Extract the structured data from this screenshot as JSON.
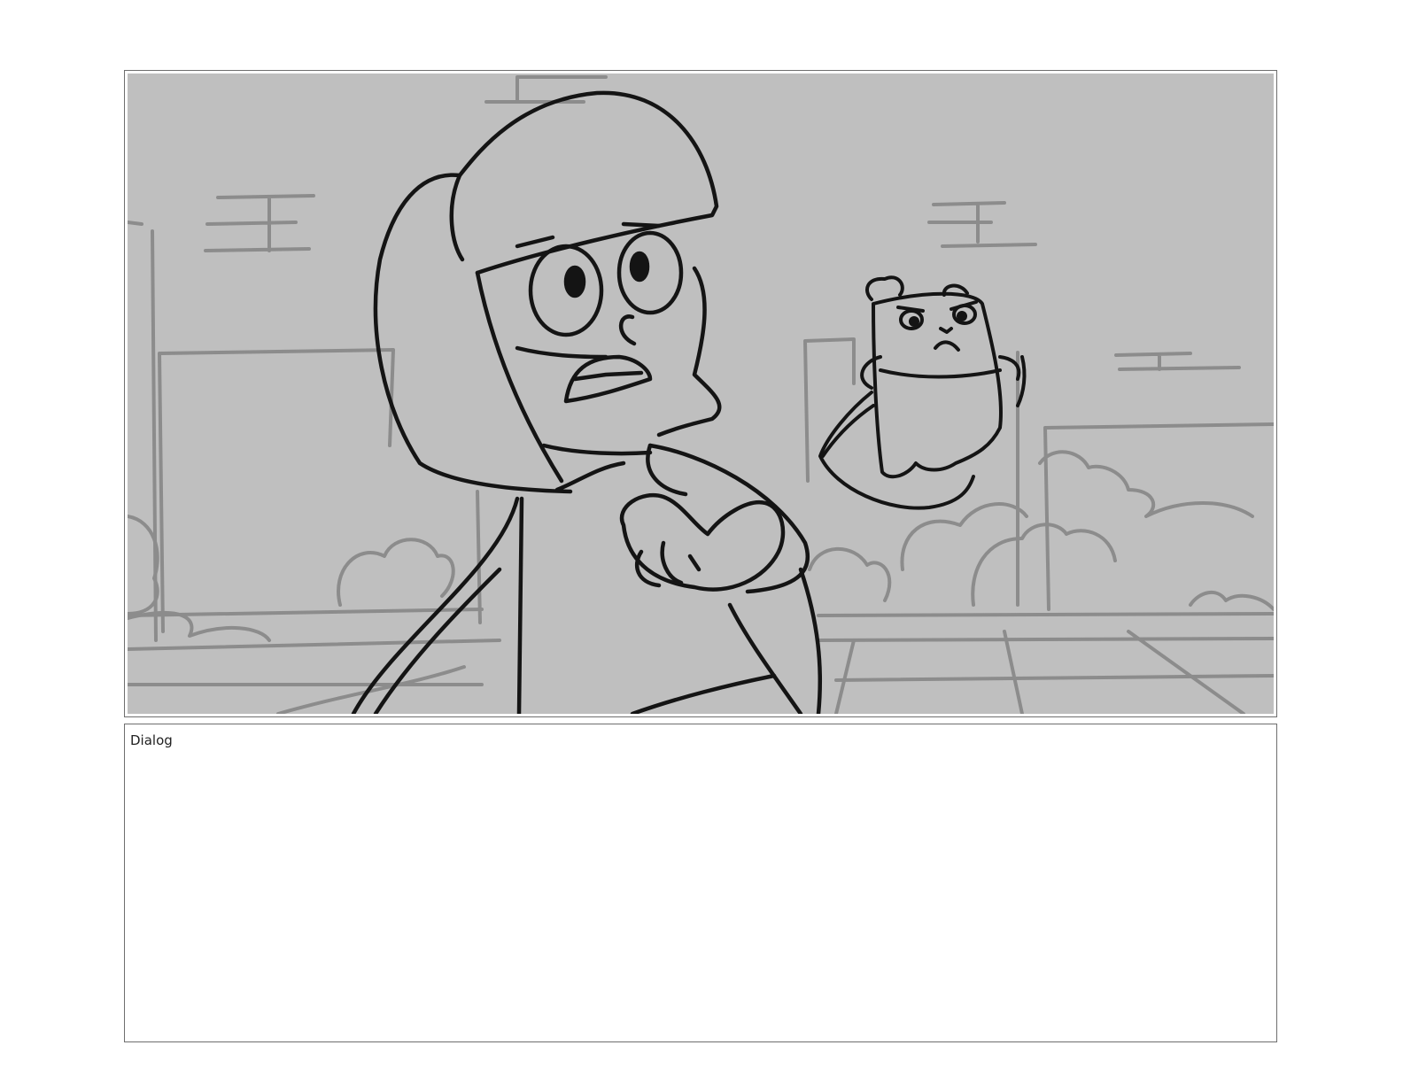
{
  "storyboard": {
    "panel": {
      "background_color": "#bfbfbf",
      "line_color": "#141414",
      "background_line_color": "#8c8c8c"
    },
    "dialog": {
      "label": "Dialog",
      "text": ""
    }
  }
}
